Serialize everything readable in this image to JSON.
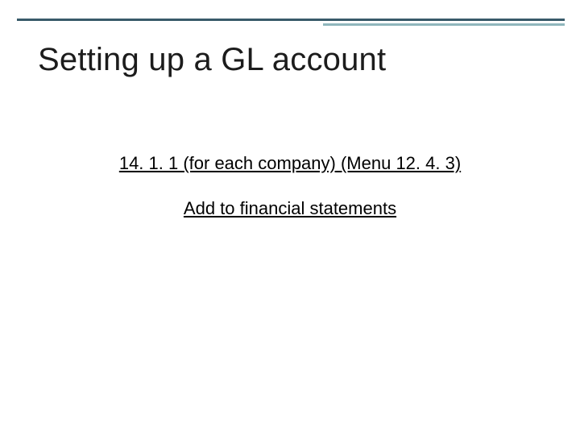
{
  "slide": {
    "title": "Setting up a GL account",
    "line1": "14. 1. 1 (for each company) (Menu 12. 4. 3)",
    "line2": "Add to financial statements"
  }
}
